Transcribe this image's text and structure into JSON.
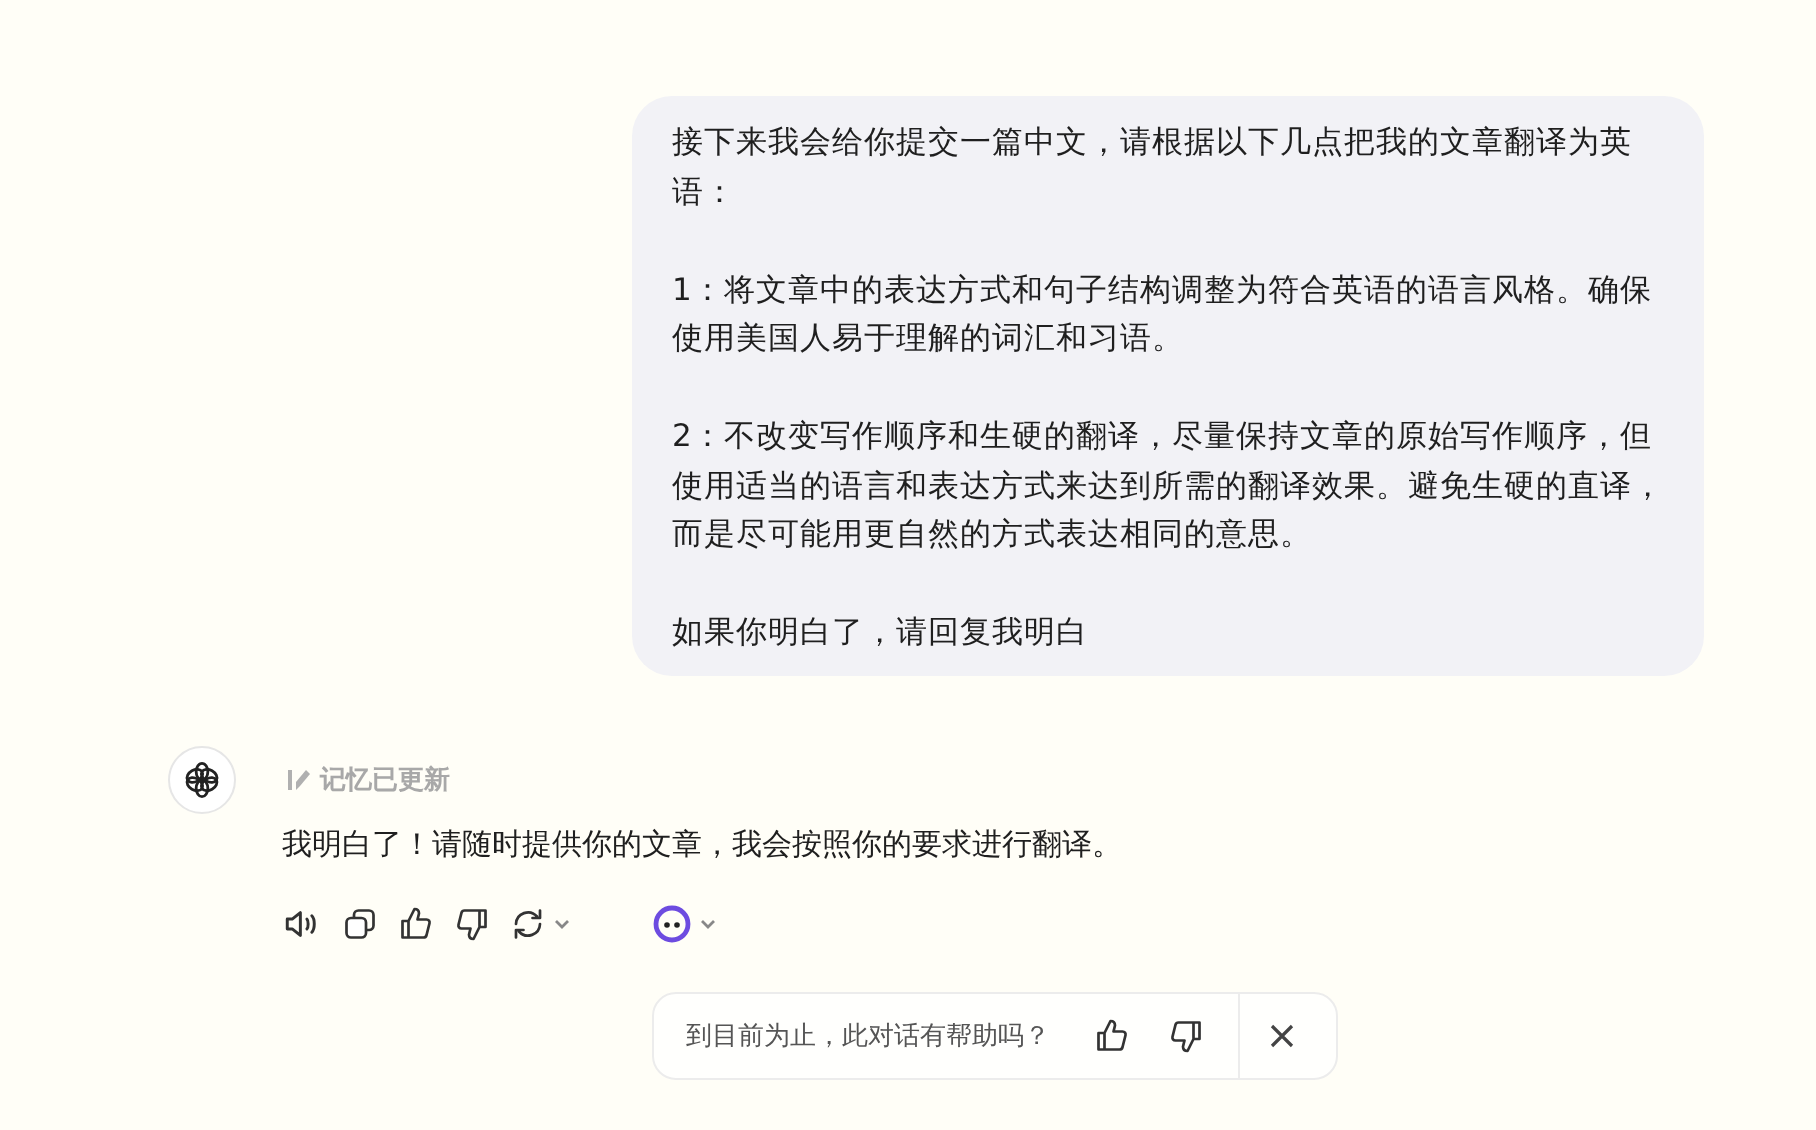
{
  "user_message": {
    "paragraphs": [
      "接下来我会给你提交一篇中文，请根据以下几点把我的文章翻译为英语：",
      "1：将文章中的表达方式和句子结构调整为符合英语的语言风格。确保使用美国人易于理解的词汇和习语。",
      "2：不改变写作顺序和生硬的翻译，尽量保持文章的原始写作顺序，但使用适当的语言和表达方式来达到所需的翻译效果。避免生硬的直译，而是尽可能用更自然的方式表达相同的意思。",
      "如果你明白了，请回复我明白"
    ]
  },
  "assistant_message": {
    "memory_note": "记忆已更新",
    "reply": "我明白了！请随时提供你的文章，我会按照你的要求进行翻译。",
    "actions": [
      {
        "kind": "speaker"
      },
      {
        "kind": "copy"
      },
      {
        "kind": "thumbs-up"
      },
      {
        "kind": "thumbs-down"
      },
      {
        "kind": "regenerate"
      },
      {
        "kind": "model"
      }
    ]
  },
  "feedback": {
    "question": "到目前为止，此对话有帮助吗？"
  }
}
